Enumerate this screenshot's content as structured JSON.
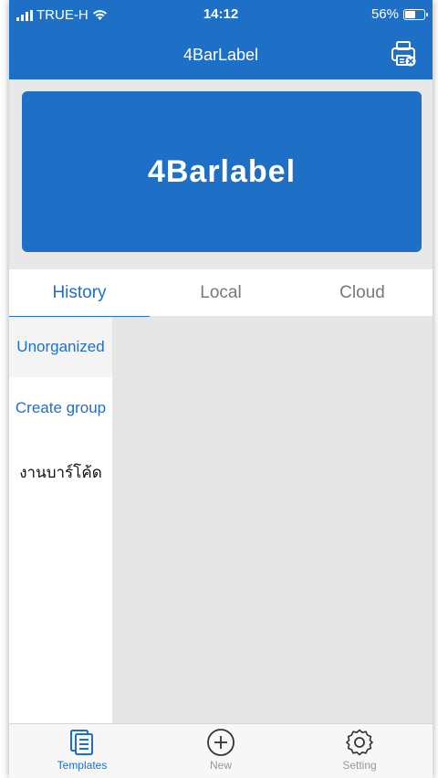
{
  "status_bar": {
    "carrier": "TRUE-H",
    "time": "14:12",
    "battery": "56%",
    "battery_level": 0.56
  },
  "nav": {
    "title": "4BarLabel",
    "printer_icon": "printer-disconnected-icon"
  },
  "banner": {
    "logo_text": "4Barlabel"
  },
  "tabs": [
    {
      "label": "History",
      "active": true
    },
    {
      "label": "Local",
      "active": false
    },
    {
      "label": "Cloud",
      "active": false
    }
  ],
  "sidebar": {
    "items": [
      {
        "label": "Unorganized",
        "style": "active"
      },
      {
        "label": "Create group",
        "style": "link"
      },
      {
        "label": "งานบาร์โค้ด",
        "style": "plain"
      }
    ]
  },
  "tabbar": {
    "items": [
      {
        "label": "Templates",
        "icon": "templates-icon",
        "active": true
      },
      {
        "label": "New",
        "icon": "add-circle-icon",
        "active": false
      },
      {
        "label": "Setting",
        "icon": "gear-icon",
        "active": false
      }
    ]
  },
  "colors": {
    "primary": "#1e6fc6",
    "content_bg": "#e6e6e6",
    "inactive": "#999999"
  }
}
